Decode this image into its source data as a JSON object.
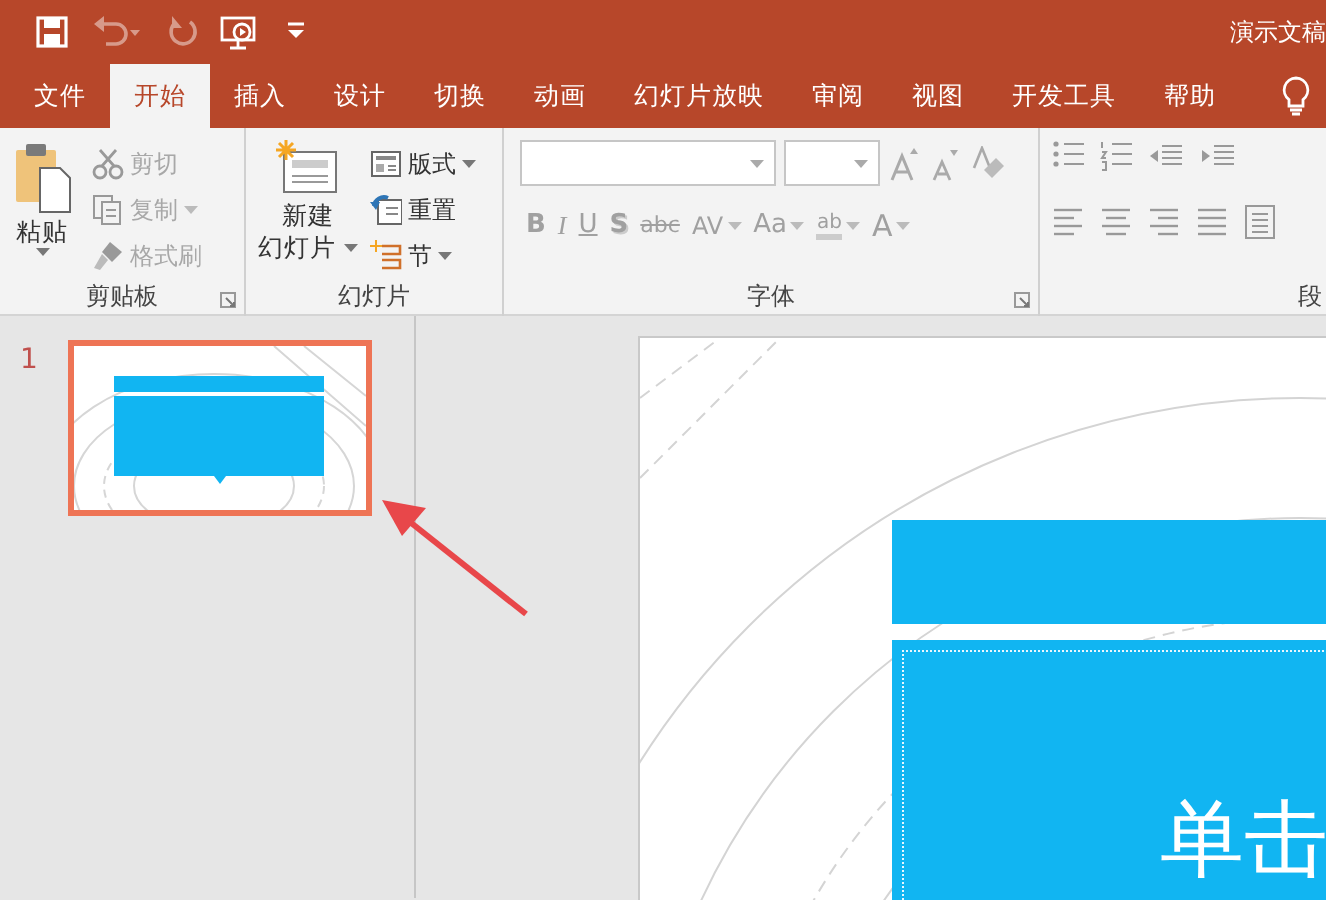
{
  "title_bar": {
    "title": "演示文稿",
    "quick_access": [
      {
        "kind": "save",
        "disabled": false
      },
      {
        "kind": "undo",
        "disabled": true
      },
      {
        "kind": "redo",
        "disabled": true
      },
      {
        "kind": "present",
        "disabled": false
      },
      {
        "kind": "customize",
        "disabled": false
      }
    ]
  },
  "tabs": [
    {
      "label": "文件",
      "selected": false
    },
    {
      "label": "开始",
      "selected": true
    },
    {
      "label": "插入",
      "selected": false
    },
    {
      "label": "设计",
      "selected": false
    },
    {
      "label": "切换",
      "selected": false
    },
    {
      "label": "动画",
      "selected": false
    },
    {
      "label": "幻灯片放映",
      "selected": false
    },
    {
      "label": "审阅",
      "selected": false
    },
    {
      "label": "视图",
      "selected": false
    },
    {
      "label": "开发工具",
      "selected": false
    },
    {
      "label": "帮助",
      "selected": false
    }
  ],
  "clipboard": {
    "label": "剪贴板",
    "launcher": true,
    "paste": {
      "label": "粘贴",
      "disabled": false
    },
    "items": [
      {
        "kind": "cut",
        "label": "剪切",
        "disabled": true,
        "caret": false
      },
      {
        "kind": "copy",
        "label": "复制",
        "disabled": true,
        "caret": true
      },
      {
        "kind": "brush",
        "label": "格式刷",
        "disabled": true,
        "caret": false
      }
    ]
  },
  "slides": {
    "label": "幻灯片",
    "launcher": false,
    "new_slide": [
      "新建",
      "幻灯片"
    ],
    "items": [
      {
        "kind": "layout",
        "label": "版式",
        "caret": true
      },
      {
        "kind": "reset",
        "label": "重置",
        "caret": false
      },
      {
        "kind": "section",
        "label": "节",
        "caret": true
      }
    ]
  },
  "font": {
    "label": "字体",
    "launcher": true,
    "buttons": [
      {
        "kind": "bold",
        "text": "B",
        "disabled": true,
        "caret": false
      },
      {
        "kind": "italic",
        "text": "I",
        "disabled": true,
        "caret": false
      },
      {
        "kind": "underline",
        "text": "U",
        "disabled": true,
        "caret": false
      },
      {
        "kind": "shadow",
        "text": "S",
        "disabled": true,
        "caret": false
      },
      {
        "kind": "strike",
        "text": "abc",
        "disabled": true,
        "caret": false
      },
      {
        "kind": "spacing",
        "text": "AV",
        "disabled": true,
        "caret": true
      },
      {
        "kind": "case",
        "text": "Aa",
        "disabled": true,
        "caret": true
      },
      {
        "kind": "highlight",
        "text": "ab",
        "disabled": true,
        "caret": true
      },
      {
        "kind": "color",
        "text": "A",
        "disabled": true,
        "caret": true
      }
    ]
  },
  "paragraph": {
    "label": "段"
  },
  "slide_pane": {
    "slides": [
      {
        "number": "1",
        "selected": true
      }
    ]
  },
  "slide": {
    "text": "单击"
  }
}
